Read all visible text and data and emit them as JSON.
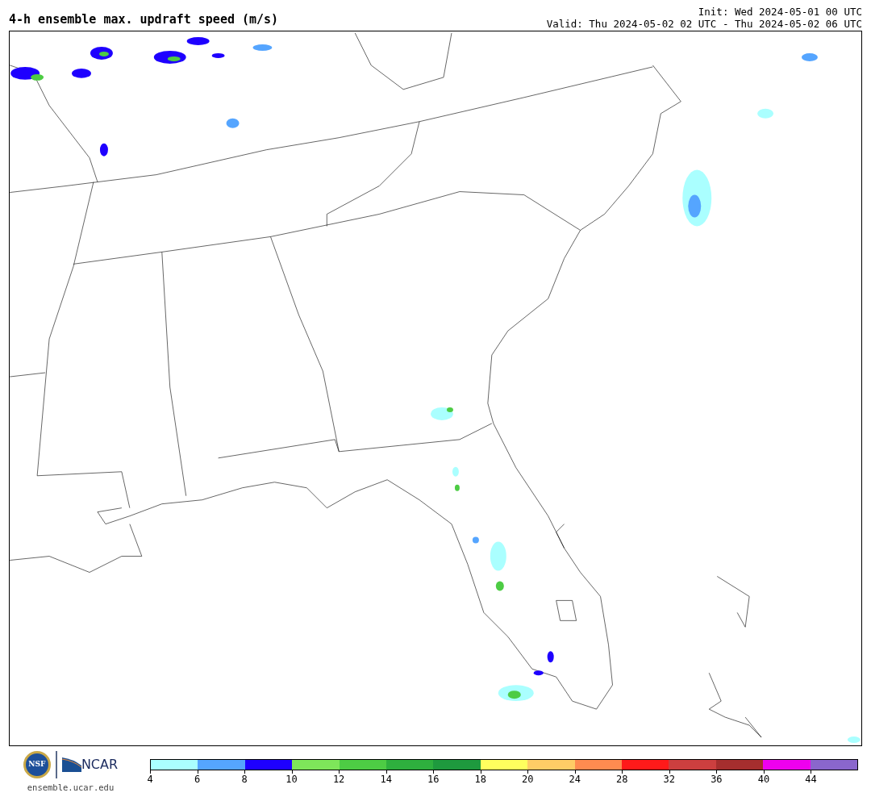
{
  "title": "4-h ensemble max. updraft speed (m/s)",
  "init": "Init: Wed 2024-05-01 00 UTC",
  "valid": "Valid: Thu 2024-05-02 02 UTC - Thu 2024-05-02 06 UTC",
  "logos": {
    "seal_text": "NSF",
    "wordmark": "NCAR",
    "url": "ensemble.ucar.edu"
  },
  "colorbar": {
    "segments": [
      {
        "color": "#aaffff",
        "tick": "4"
      },
      {
        "color": "#55a5ff",
        "tick": "6"
      },
      {
        "color": "#1e00ff",
        "tick": "8"
      },
      {
        "color": "#7ee55a",
        "tick": "10"
      },
      {
        "color": "#4dcc44",
        "tick": "12"
      },
      {
        "color": "#2eb03e",
        "tick": "14"
      },
      {
        "color": "#1e9a3e",
        "tick": "16"
      },
      {
        "color": "#ffff5e",
        "tick": "18"
      },
      {
        "color": "#ffcc66",
        "tick": "20"
      },
      {
        "color": "#ff8b50",
        "tick": "24"
      },
      {
        "color": "#ff1a1a",
        "tick": "28"
      },
      {
        "color": "#cc3f3f",
        "tick": "32"
      },
      {
        "color": "#a52e2e",
        "tick": "36"
      },
      {
        "color": "#ee00ee",
        "tick": "40"
      },
      {
        "color": "#8a66cc",
        "tick": "44"
      }
    ]
  }
}
